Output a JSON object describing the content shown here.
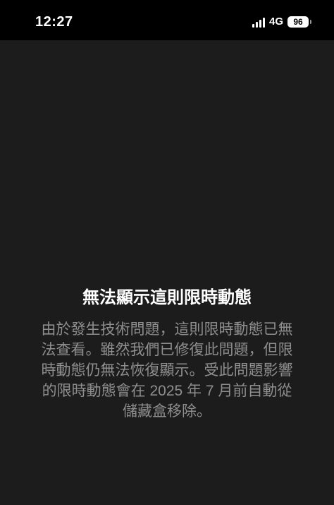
{
  "status_bar": {
    "time": "12:27",
    "network": "4G",
    "battery_level": "96",
    "icons": [
      "signal-bars-icon",
      "battery-icon"
    ]
  },
  "story_unavailable": {
    "title": "無法顯示這則限時動態",
    "message": "由於發生技術問題，這則限時動態已無法查看。雖然我們已修復此問題，但限時動態仍無法恢復顯示。受此問題影響的限時動態會在 2025 年 7 月前自動從儲藏盒移除。"
  },
  "colors": {
    "status_bar_background": "#000000",
    "page_background": "#1c1c1c",
    "title_text": "#ffffff",
    "message_text": "#8e8e8e"
  }
}
